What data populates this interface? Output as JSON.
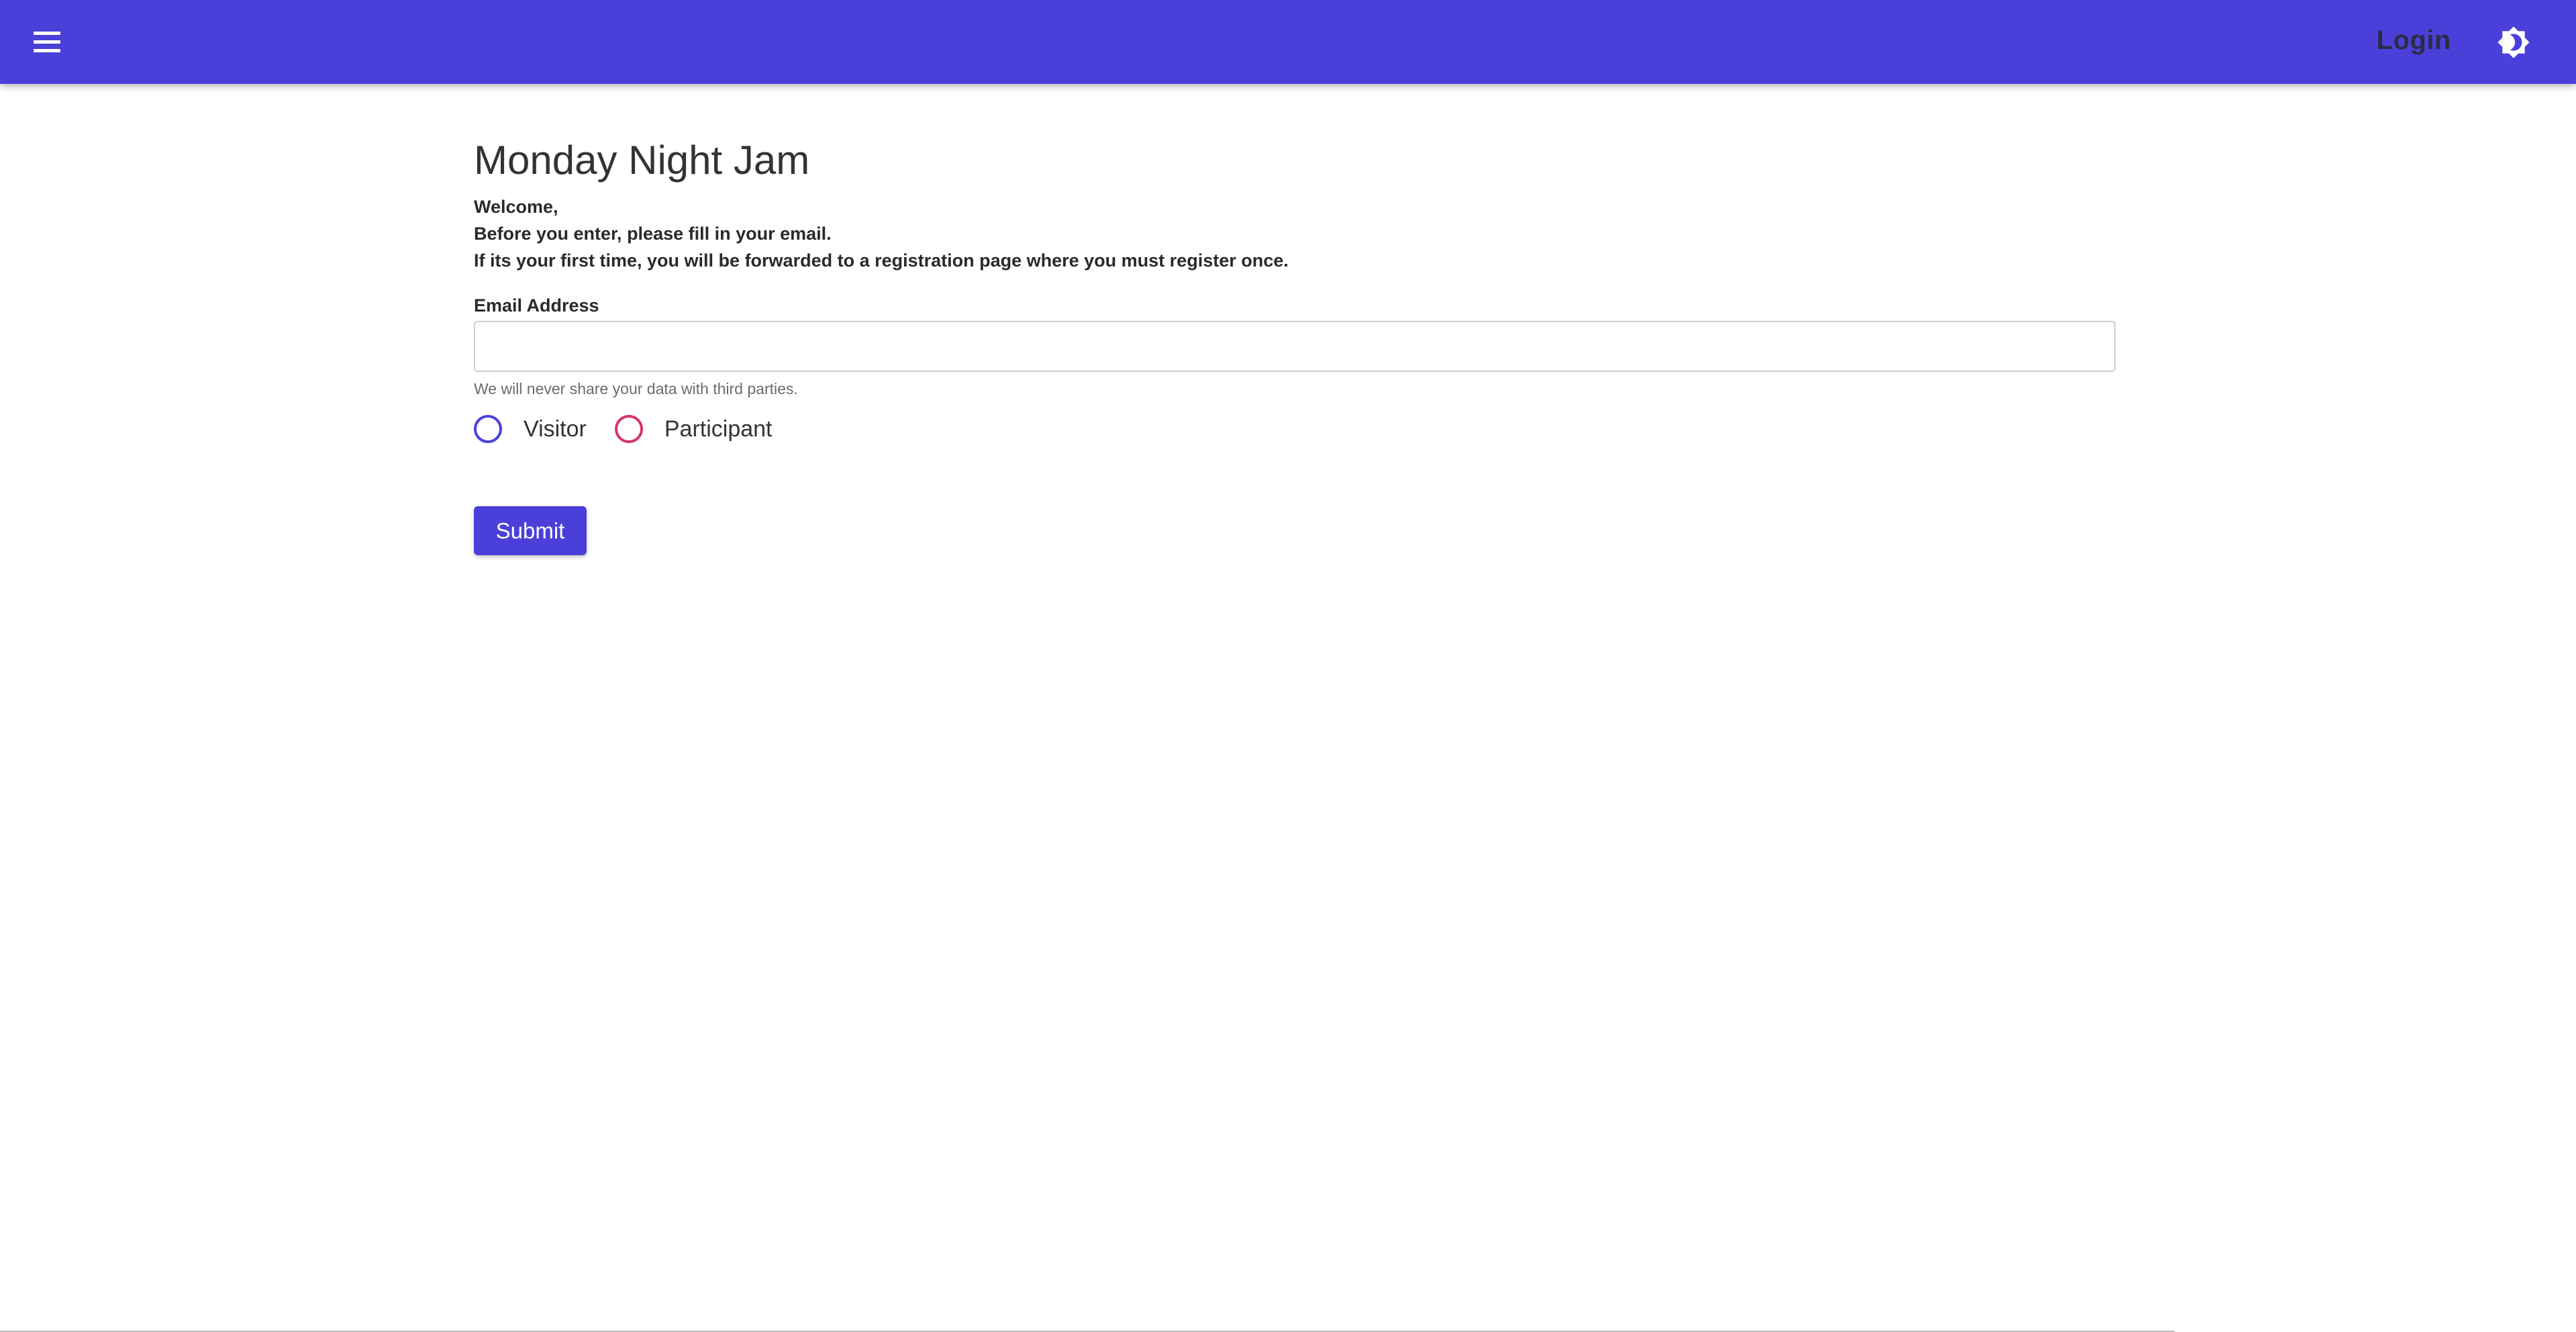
{
  "header": {
    "login_label": "Login",
    "menu_icon": "menu-icon",
    "theme_icon": "brightness-icon",
    "bar_color": "#4a40d9"
  },
  "main": {
    "title": "Monday Night Jam",
    "intro_lines": [
      "Welcome,",
      "Before you enter, please fill in your email.",
      "If its your first time, you will be forwarded to a registration page where you must register once."
    ],
    "email": {
      "label": "Email Address",
      "value": "",
      "help_text": "We will never share your data with third parties."
    },
    "role_options": [
      {
        "label": "Visitor",
        "color": "#4a40d9",
        "selected": false
      },
      {
        "label": "Participant",
        "color": "#d8336a",
        "selected": false
      }
    ],
    "submit_label": "Submit"
  }
}
